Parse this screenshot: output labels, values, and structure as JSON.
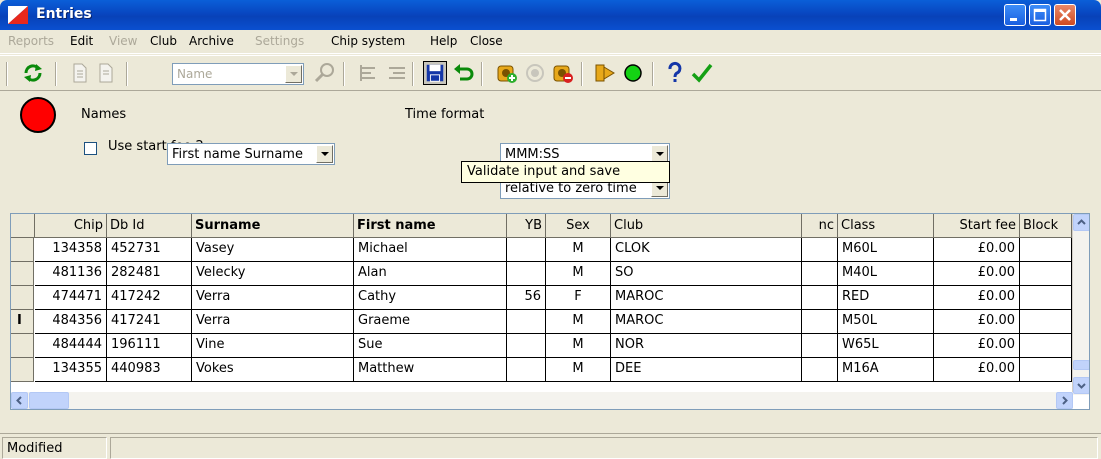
{
  "window": {
    "title": "Entries"
  },
  "menu": [
    {
      "label": "Reports",
      "enabled": false
    },
    {
      "label": "Edit",
      "enabled": true
    },
    {
      "label": "View",
      "enabled": false
    },
    {
      "label": "Club",
      "enabled": true
    },
    {
      "label": "Archive",
      "enabled": true
    },
    {
      "label": "Settings",
      "enabled": false
    },
    {
      "label": "Chip system",
      "enabled": true
    },
    {
      "label": "Help",
      "enabled": true
    },
    {
      "label": "Close",
      "enabled": true
    }
  ],
  "toolbar": {
    "name_combo_value": "Name"
  },
  "options": {
    "names_label": "Names",
    "names_value": "First name Surname",
    "start_fee_label": "Use start fee 2",
    "start_fee_checked": false,
    "time_format_label": "Time format",
    "time_format_value": "MMM:SS",
    "relative_value": "relative to zero time",
    "tooltip": "Validate input and save",
    "status_light_color": "#ff0000"
  },
  "table": {
    "columns": [
      "Chip",
      "Db Id",
      "Surname",
      "First name",
      "YB",
      "Sex",
      "Club",
      "nc",
      "Class",
      "Start fee",
      "Block"
    ],
    "rows": [
      [
        "134358",
        "452731",
        "Vasey",
        "Michael",
        "",
        "M",
        "CLOK",
        "",
        "M60L",
        "£0.00",
        ""
      ],
      [
        "481136",
        "282481",
        "Velecky",
        "Alan",
        "",
        "M",
        "SO",
        "",
        "M40L",
        "£0.00",
        ""
      ],
      [
        "474471",
        "417242",
        "Verra",
        "Cathy",
        "56",
        "F",
        "MAROC",
        "",
        "RED",
        "£0.00",
        ""
      ],
      [
        "484356",
        "417241",
        "Verra",
        "Graeme",
        "",
        "M",
        "MAROC",
        "",
        "M50L",
        "£0.00",
        ""
      ],
      [
        "484444",
        "196111",
        "Vine",
        "Sue",
        "",
        "M",
        "NOR",
        "",
        "W65L",
        "£0.00",
        ""
      ],
      [
        "134355",
        "440983",
        "Vokes",
        "Matthew",
        "",
        "M",
        "DEE",
        "",
        "M16A",
        "£0.00",
        ""
      ]
    ],
    "current_row_marker": "I"
  },
  "status": {
    "text": "Modified"
  }
}
